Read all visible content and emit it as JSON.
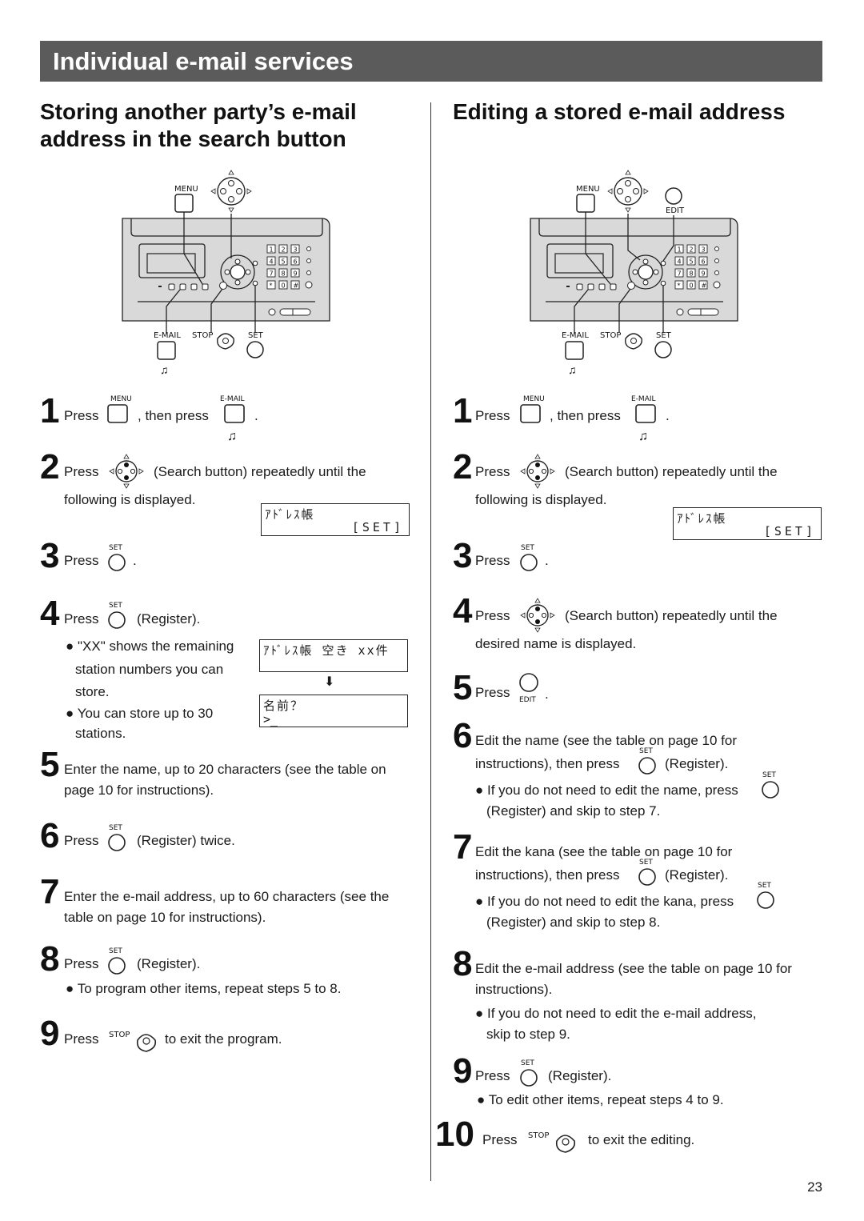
{
  "banner": {
    "title": "Individual e-mail services"
  },
  "left": {
    "heading_line1": "Storing another party’s e-mail",
    "heading_line2": "address in the search button",
    "diagram_labels": {
      "menu": "MENU",
      "email": "E-MAIL",
      "stop": "STOP",
      "set": "SET"
    },
    "steps": {
      "s1": {
        "num": "1",
        "press": "Press",
        "then": ", then press",
        "end": ".",
        "icon1_label": "MENU",
        "icon2_label": "E-MAIL"
      },
      "s2": {
        "num": "2",
        "press": "Press",
        "text": "(Search button) repeatedly until the",
        "text2": "following is displayed."
      },
      "s3": {
        "num": "3",
        "press": "Press",
        "end": ".",
        "icon_label": "SET"
      },
      "s4": {
        "num": "4",
        "press": "Press",
        "text": "(Register).",
        "icon_label": "SET",
        "bullets": [
          "\"XX\" shows the remaining",
          "station numbers you can",
          "store.",
          "You can store up to 30",
          "stations."
        ]
      },
      "s5": {
        "num": "5",
        "text": "Enter the name, up to 20 characters (see the table on",
        "text2": "page 10 for instructions)."
      },
      "s6": {
        "num": "6",
        "press": "Press",
        "text": "(Register) twice.",
        "icon_label": "SET"
      },
      "s7": {
        "num": "7",
        "text": "Enter the e-mail address, up to 60 characters (see the",
        "text2": "table on page 10 for instructions)."
      },
      "s8": {
        "num": "8",
        "press": "Press",
        "text": "(Register).",
        "icon_label": "SET",
        "bullet": "To program other items, repeat steps 5 to 8."
      },
      "s9": {
        "num": "9",
        "press": "Press",
        "text": "to exit the program.",
        "icon_label": "STOP"
      }
    },
    "lcd1": {
      "line1": "ｱﾄﾞﾚｽ帳",
      "line2": "[SET]"
    },
    "lcd2": {
      "line1": "ｱﾄﾞﾚｽ帳 空き xx件",
      "line2": ""
    },
    "lcd3": {
      "line1": "名前？",
      "line2": ">_"
    },
    "arrow": "⬇"
  },
  "right": {
    "heading": "Editing a stored e-mail address",
    "diagram_labels": {
      "menu": "MENU",
      "email": "E-MAIL",
      "stop": "STOP",
      "set": "SET",
      "edit": "EDIT"
    },
    "steps": {
      "s1": {
        "num": "1",
        "press": "Press",
        "then": ", then press",
        "end": ".",
        "icon1_label": "MENU",
        "icon2_label": "E-MAIL"
      },
      "s2": {
        "num": "2",
        "press": "Press",
        "text": "(Search button) repeatedly until the",
        "text2": "following is displayed."
      },
      "s3": {
        "num": "3",
        "press": "Press",
        "end": ".",
        "icon_label": "SET"
      },
      "s4": {
        "num": "4",
        "press": "Press",
        "text": "(Search button) repeatedly until the",
        "text2": "desired name is displayed."
      },
      "s5": {
        "num": "5",
        "press": "Press",
        "end": ".",
        "icon_label": "EDIT"
      },
      "s6": {
        "num": "6",
        "text": "Edit the name (see the table on page 10 for",
        "text2a": "instructions), then press",
        "text2b": "(Register).",
        "icon_label": "SET",
        "bullet1": "If you do not need to edit the name, press",
        "bullet2": "(Register) and skip to step 7."
      },
      "s7": {
        "num": "7",
        "text": "Edit the kana (see the table on page 10 for",
        "text2a": "instructions), then press",
        "text2b": "(Register).",
        "icon_label": "SET",
        "bullet1": "If you do not need to edit the kana, press",
        "bullet2": "(Register) and skip to step 8."
      },
      "s8": {
        "num": "8",
        "text": "Edit the e-mail address (see the table on page 10 for",
        "text2": "instructions).",
        "bullet1": "If you do not need to edit the e-mail address,",
        "bullet2": "skip to step 9."
      },
      "s9": {
        "num": "9",
        "press": "Press",
        "text": "(Register).",
        "icon_label": "SET",
        "bullet": "To edit other items, repeat steps 4 to 9."
      },
      "s10": {
        "num": "10",
        "press": "Press",
        "text": "to exit the editing.",
        "icon_label": "STOP"
      }
    },
    "lcd1": {
      "line1": "ｱﾄﾞﾚｽ帳",
      "line2": "[SET]"
    }
  },
  "footer": {
    "page_number": "23"
  }
}
